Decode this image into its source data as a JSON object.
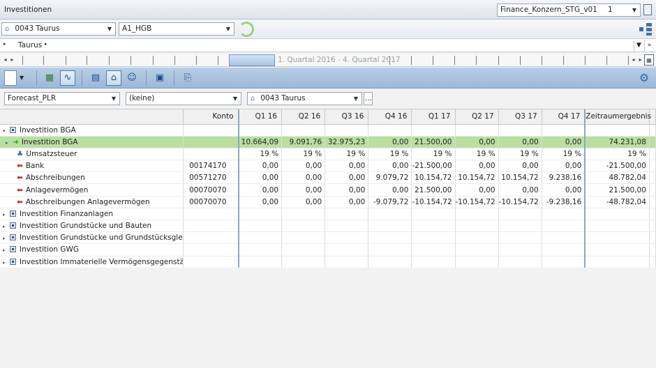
{
  "window": {
    "title": "Investitionen",
    "version_combo": "Finance_Konzern_STG_v01",
    "version_number": "1"
  },
  "context": {
    "entity_combo": "0043 Taurus",
    "ledger_combo": "A1_HGB"
  },
  "breadcrumb": {
    "text": "Taurus"
  },
  "timeline": {
    "range_label": "1. Quartal 2016 - 4. Quartal 2017"
  },
  "toolbar": {
    "icons": [
      "new-doc-icon",
      "excel-icon",
      "chart-icon",
      "report-icon",
      "home-icon",
      "person-icon",
      "bus-icon",
      "import-icon",
      "settings-icon"
    ]
  },
  "filters": {
    "scenario": "Forecast_PLR",
    "dimension": "(keine)",
    "entity": "0043 Taurus",
    "more": "..."
  },
  "table": {
    "headers": [
      "",
      "Konto",
      "Q1 16",
      "Q2 16",
      "Q3 16",
      "Q4 16",
      "Q1 17",
      "Q2 17",
      "Q3 17",
      "Q4 17",
      "Zeitraumergebnis"
    ],
    "rows": [
      {
        "name": "Investition BGA",
        "konto": "",
        "vals": [
          "",
          "",
          "",
          "",
          "",
          "",
          "",
          "",
          ""
        ]
      },
      {
        "name": "Investition BGA",
        "konto": "",
        "vals": [
          "10.664,09",
          "9.091,76",
          "32.975,23",
          "0,00",
          "21.500,00",
          "0,00",
          "0,00",
          "0,00",
          "74.231,08"
        ]
      },
      {
        "name": "Umsatzsteuer",
        "konto": "",
        "vals": [
          "19 %",
          "19 %",
          "19 %",
          "19 %",
          "19 %",
          "19 %",
          "19 %",
          "19 %",
          "19 %"
        ]
      },
      {
        "name": "Bank",
        "konto": "00174170",
        "vals": [
          "0,00",
          "0,00",
          "0,00",
          "0,00",
          "-21.500,00",
          "0,00",
          "0,00",
          "0,00",
          "-21.500,00"
        ]
      },
      {
        "name": "Abschreibungen",
        "konto": "00571270",
        "vals": [
          "0,00",
          "0,00",
          "0,00",
          "9.079,72",
          "10.154,72",
          "10.154,72",
          "10.154,72",
          "9.238,16",
          "48.782,04"
        ]
      },
      {
        "name": "Anlagevermögen",
        "konto": "00070070",
        "vals": [
          "0,00",
          "0,00",
          "0,00",
          "0,00",
          "21.500,00",
          "0,00",
          "0,00",
          "0,00",
          "21.500,00"
        ]
      },
      {
        "name": "Abschreibungen Anlagevermögen",
        "konto": "00070070",
        "vals": [
          "0,00",
          "0,00",
          "0,00",
          "-9.079,72",
          "-10.154,72",
          "-10.154,72",
          "-10.154,72",
          "-9.238,16",
          "-48.782,04"
        ]
      },
      {
        "name": "Investition Finanzanlagen",
        "konto": "",
        "vals": [
          "",
          "",
          "",
          "",
          "",
          "",
          "",
          "",
          ""
        ]
      },
      {
        "name": "Investition Grundstücke und Bauten",
        "konto": "",
        "vals": [
          "",
          "",
          "",
          "",
          "",
          "",
          "",
          "",
          ""
        ]
      },
      {
        "name": "Investition Grundstücke und Grundstücksgleic...",
        "konto": "",
        "vals": [
          "",
          "",
          "",
          "",
          "",
          "",
          "",
          "",
          ""
        ]
      },
      {
        "name": "Investition GWG",
        "konto": "",
        "vals": [
          "",
          "",
          "",
          "",
          "",
          "",
          "",
          "",
          ""
        ]
      },
      {
        "name": "Investition Immaterielle Vermögensgegenstän...",
        "konto": "",
        "vals": [
          "",
          "",
          "",
          "",
          "",
          "",
          "",
          "",
          ""
        ]
      }
    ]
  }
}
